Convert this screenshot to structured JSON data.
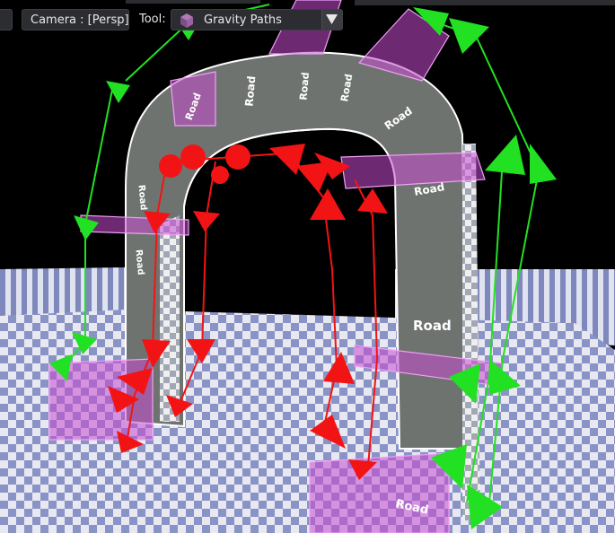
{
  "toolbar": {
    "camera_label": "Camera : [Persp]",
    "tool_label": "Tool:",
    "tool_value": "Gravity Paths",
    "tool_icon": "cube-icon",
    "dropdown_icon": "triangle-down-icon"
  },
  "scene": {
    "road_label": "Road",
    "colors": {
      "sky": "#000000",
      "floor_a": "#8a93c6",
      "floor_b": "#e7e8f0",
      "road": "#6f7370",
      "highlight": "#d44cd9",
      "path_green": "#22e022",
      "path_red": "#f21414"
    }
  }
}
